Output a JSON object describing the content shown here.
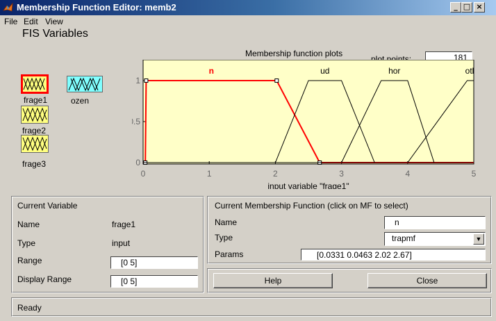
{
  "window": {
    "title": "Membership Function Editor: memb2",
    "min_label": "_",
    "max_label": "□",
    "close_label": "×"
  },
  "menu": [
    "File",
    "Edit",
    "View"
  ],
  "fis_variables": {
    "label": "FIS Variables",
    "inputs": [
      "frage1",
      "frage2",
      "frage3"
    ],
    "outputs": [
      "ozen"
    ]
  },
  "plot": {
    "title": "Membership function plots",
    "plot_points_label": "plot points:",
    "plot_points_value": "181",
    "xlabel": "input variable \"frage1\"",
    "chart_data": {
      "type": "line",
      "xlim": [
        0,
        5
      ],
      "ylim": [
        0,
        1
      ],
      "x_ticks": [
        "0",
        "1",
        "2",
        "3",
        "4",
        "5"
      ],
      "y_ticks": [
        "0",
        "0.5",
        "1"
      ],
      "series": [
        {
          "name": "n",
          "x": [
            0.0331,
            0.0463,
            2.02,
            2.67
          ],
          "y": [
            0,
            1,
            1,
            0
          ],
          "selected": true
        },
        {
          "name": "ud",
          "x": [
            2.0,
            2.5,
            3.0,
            3.5
          ],
          "y": [
            0,
            1,
            1,
            0
          ]
        },
        {
          "name": "hor",
          "x": [
            3.0,
            3.6,
            4.0,
            4.4
          ],
          "y": [
            0,
            1,
            1,
            0
          ]
        },
        {
          "name": "otl",
          "x": [
            4.0,
            4.9,
            5.0,
            5.0
          ],
          "y": [
            0,
            1,
            1,
            1
          ]
        }
      ],
      "colors": {
        "background": "#ffffc8",
        "selected": "#ff0000",
        "normal": "#000000"
      }
    }
  },
  "current_variable": {
    "header": "Current Variable",
    "name_label": "Name",
    "name_value": "frage1",
    "type_label": "Type",
    "type_value": "input",
    "range_label": "Range",
    "range_value": "[0 5]",
    "display_range_label": "Display Range",
    "display_range_value": "[0 5]"
  },
  "current_mf": {
    "header": "Current Membership Function (click on MF to select)",
    "name_label": "Name",
    "name_value": "n",
    "type_label": "Type",
    "type_value": "trapmf",
    "params_label": "Params",
    "params_value": "[0.0331 0.0463 2.02 2.67]"
  },
  "buttons": {
    "help": "Help",
    "close": "Close"
  },
  "status": "Ready"
}
